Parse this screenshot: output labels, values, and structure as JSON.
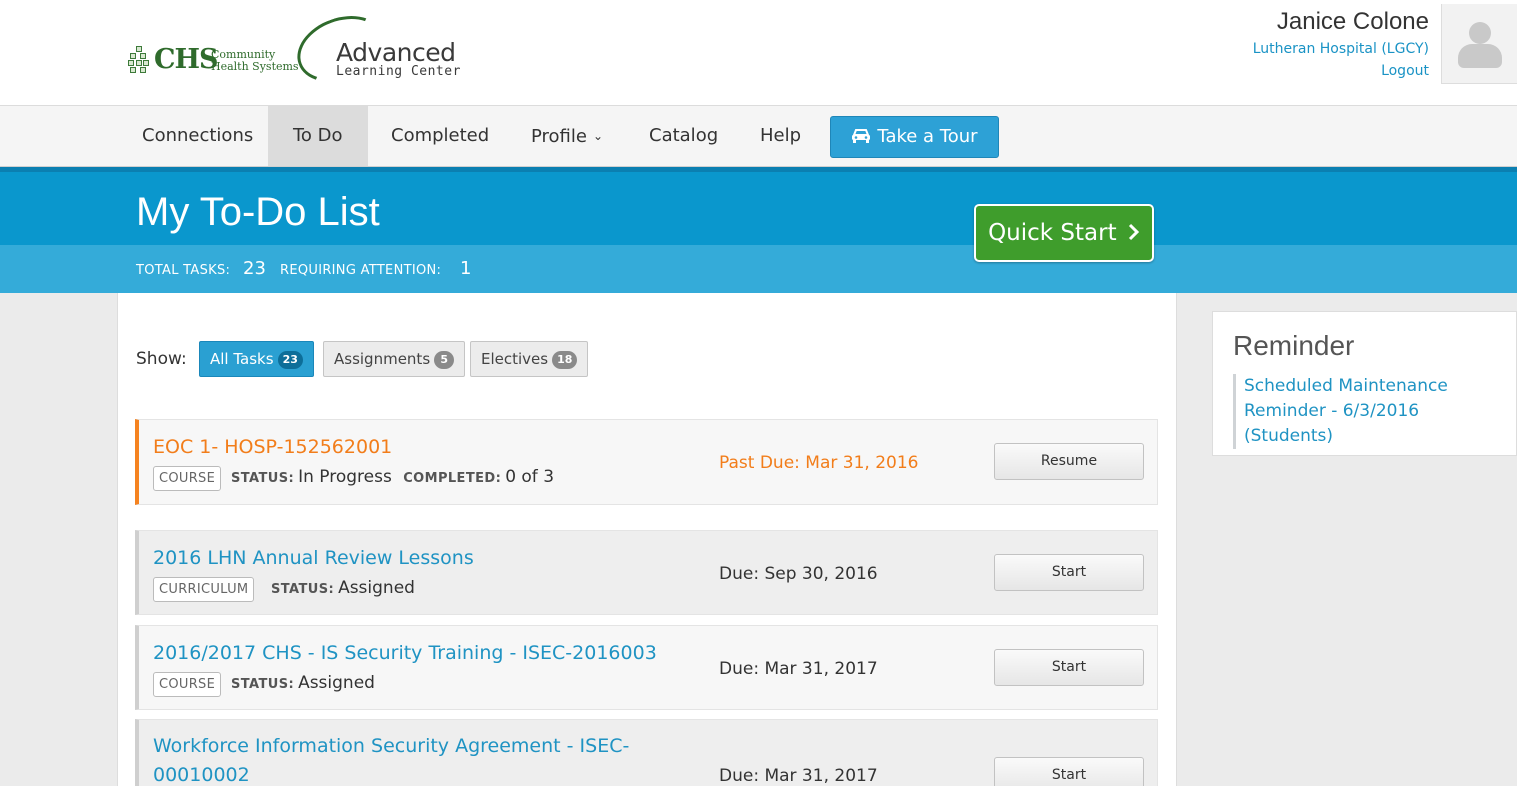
{
  "header": {
    "logo": {
      "chs_text": "CHS",
      "chs_sub_line1": "Community",
      "chs_sub_line2": "Health Systems",
      "alc_title": "Advanced",
      "alc_sub": "Learning Center"
    },
    "user": {
      "name": "Janice Colone",
      "organization": "Lutheran Hospital (LGCY)",
      "logout_label": "Logout",
      "avatar_icon": "user-silhouette-icon"
    }
  },
  "nav": {
    "items": [
      {
        "label": "Connections"
      },
      {
        "label": "To Do",
        "active": true
      },
      {
        "label": "Completed"
      },
      {
        "label": "Profile",
        "has_dropdown": true
      },
      {
        "label": "Catalog"
      },
      {
        "label": "Help"
      }
    ],
    "tour_button": {
      "label": "Take a Tour",
      "icon": "car-icon"
    },
    "accent_color": "#2da1d6"
  },
  "banner": {
    "title": "My To-Do List",
    "total_tasks_label": "TOTAL TASKS:",
    "total_tasks_value": "23",
    "attention_label": "REQUIRING ATTENTION:",
    "attention_value": "1",
    "quick_start_label": "Quick Start",
    "quick_start_icon": "chevron-right-icon",
    "banner_color": "#0a97cd",
    "quick_start_color": "#3f9d2c"
  },
  "filters": {
    "show_label": "Show:",
    "items": [
      {
        "label": "All Tasks",
        "count": "23",
        "active": true
      },
      {
        "label": "Assignments",
        "count": "5"
      },
      {
        "label": "Electives",
        "count": "18"
      }
    ]
  },
  "tasks": [
    {
      "title": "EOC 1- HOSP-152562001",
      "type": "COURSE",
      "status_label": "STATUS:",
      "status": "In Progress",
      "completed_label": "COMPLETED:",
      "completed": "0 of 3",
      "due": "Past Due: Mar 31, 2016",
      "button": "Resume",
      "overdue_color": "#f27d1a"
    },
    {
      "title": "2016 LHN Annual Review Lessons",
      "type": "CURRICULUM",
      "status_label": "STATUS:",
      "status": "Assigned",
      "due": "Due: Sep 30, 2016",
      "button": "Start"
    },
    {
      "title": "2016/2017 CHS - IS Security Training - ISEC-2016003",
      "type": "COURSE",
      "status_label": "STATUS:",
      "status": "Assigned",
      "due": "Due: Mar 31, 2017",
      "button": "Start"
    },
    {
      "title_line1": "Workforce Information Security Agreement - ISEC-",
      "title_line2": "00010002",
      "due": "Due: Mar 31, 2017",
      "button": "Start"
    }
  ],
  "reminder": {
    "title": "Reminder",
    "link_line1": "Scheduled Maintenance",
    "link_line2": "Reminder - 6/3/2016 (Students)"
  }
}
